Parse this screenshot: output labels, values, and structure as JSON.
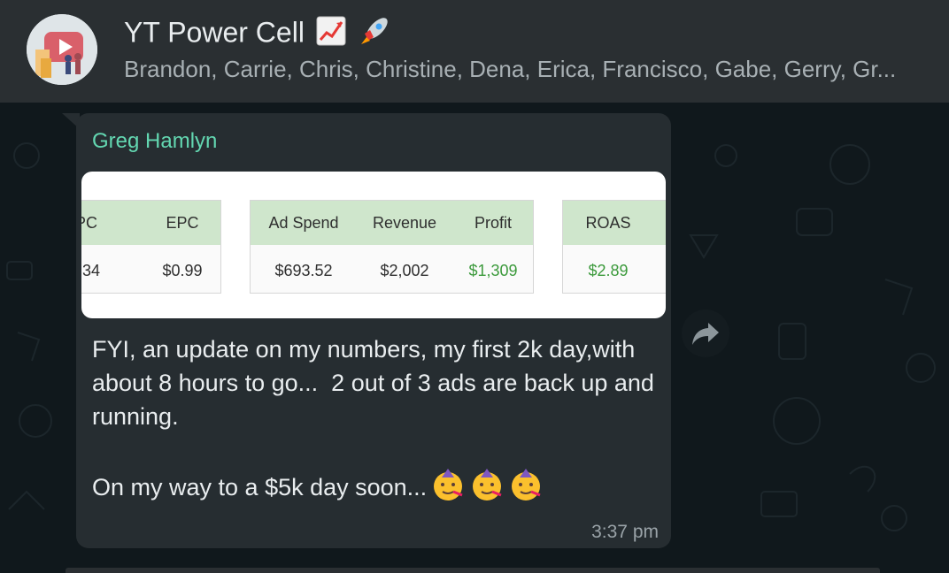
{
  "header": {
    "title": "YT Power Cell",
    "title_icons": [
      "chart-increasing-icon",
      "rocket-icon"
    ],
    "members": "Brandon, Carrie, Chris, Christine, Dena, Erica, Francisco, Gabe, Gerry, Gr..."
  },
  "message": {
    "sender": "Greg Hamlyn",
    "text": "FYI, an update on my numbers, my first 2k day,with about 8 hours to go...  2 out of 3 ads are back up and running.\n\nOn my way to a $5k day soon...",
    "text_emojis": [
      "partying-face-icon",
      "partying-face-icon",
      "partying-face-icon"
    ],
    "time": "3:37 pm",
    "attachment": {
      "table1": {
        "headers": [
          "PC",
          "EPC"
        ],
        "values": [
          "34",
          "$0.99"
        ]
      },
      "table2": {
        "headers": [
          "Ad Spend",
          "Revenue",
          "Profit"
        ],
        "values": [
          "$693.52",
          "$2,002",
          "$1,309"
        ]
      },
      "table3": {
        "headers": [
          "ROAS"
        ],
        "values": [
          "$2.89"
        ]
      }
    }
  },
  "colors": {
    "sender": "#63d7b1",
    "bubble": "#262d31",
    "header": "#2a2f32",
    "table_header": "#cfe6cc",
    "positive_value": "#3c9a3c"
  }
}
